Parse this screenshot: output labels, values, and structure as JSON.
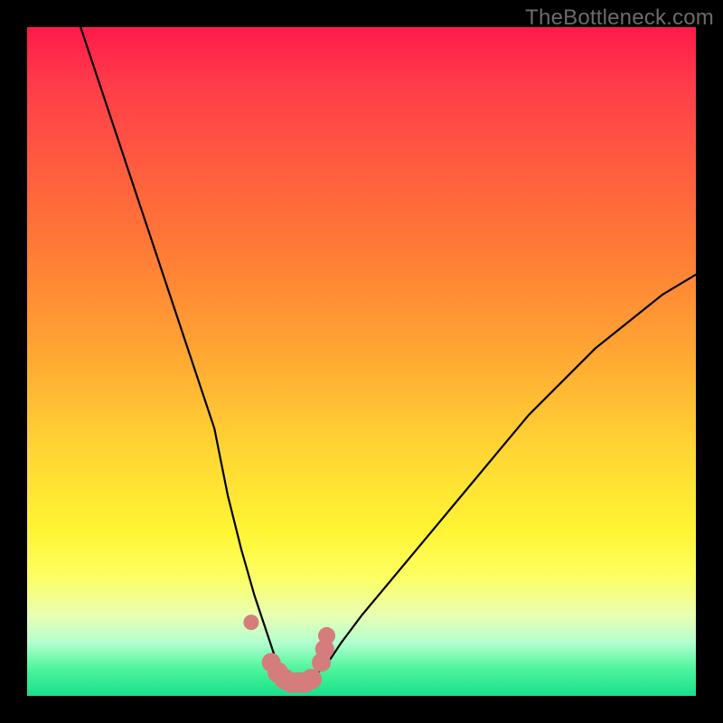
{
  "watermark": "TheBottleneck.com",
  "colors": {
    "background": "#000000",
    "gradient_top": "#ff1a4a",
    "gradient_bottom": "#18e08a",
    "curve": "#000000",
    "markers": "#d57d7d"
  },
  "chart_data": {
    "type": "line",
    "title": "",
    "xlabel": "",
    "ylabel": "",
    "xlim": [
      0,
      100
    ],
    "ylim": [
      0,
      100
    ],
    "grid": false,
    "legend": false,
    "series": [
      {
        "name": "bottleneck-curve",
        "x": [
          8,
          12,
          16,
          20,
          24,
          28,
          30,
          32,
          34,
          36,
          37,
          38,
          39,
          40,
          41,
          43,
          45,
          47,
          50,
          55,
          60,
          65,
          70,
          75,
          80,
          85,
          90,
          95,
          100
        ],
        "values": [
          100,
          88,
          76,
          64,
          52,
          40,
          30,
          22,
          15,
          9,
          6,
          4,
          3,
          2,
          2,
          3,
          5,
          8,
          12,
          18,
          24,
          30,
          36,
          42,
          47,
          52,
          56,
          60,
          63
        ]
      }
    ],
    "markers": {
      "name": "bottom-data-points",
      "x": [
        33.5,
        36.5,
        37.5,
        38.5,
        39.5,
        40.5,
        41.5,
        42.5,
        44.0,
        44.5,
        44.8
      ],
      "y": [
        11.0,
        5.0,
        3.5,
        2.5,
        2.0,
        2.0,
        2.0,
        2.5,
        5.0,
        7.0,
        9.0
      ],
      "radius": [
        8,
        10,
        11,
        11,
        11,
        11,
        11,
        11,
        10,
        10,
        9
      ]
    }
  }
}
